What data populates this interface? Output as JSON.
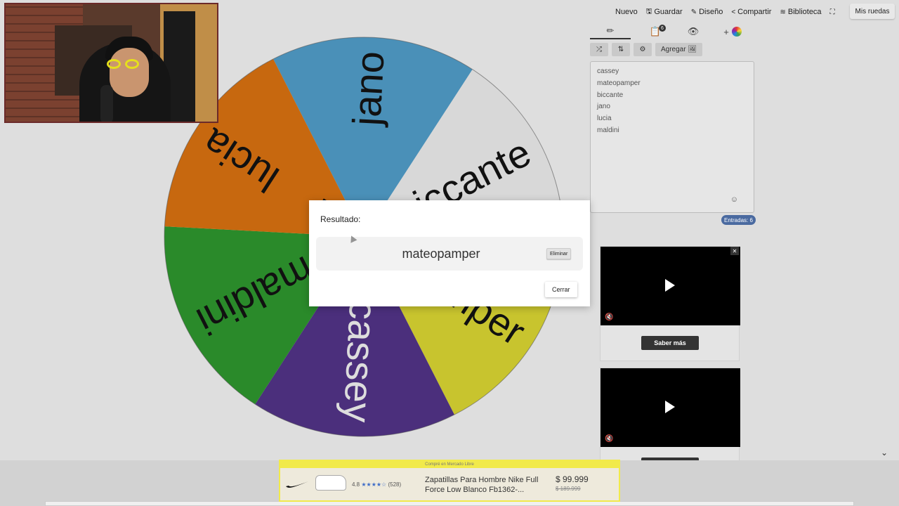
{
  "topmenu": {
    "nuevo": "Nuevo",
    "guardar": "Guardar",
    "diseno": "Diseño",
    "compartir": "Compartir",
    "biblioteca": "Biblioteca",
    "mis_ruedas": "Mis ruedas"
  },
  "tabs": {
    "list_badge": "6"
  },
  "toolbar": {
    "agregar": "Agregar"
  },
  "entries": [
    "cassey",
    "mateopamper",
    "biccante",
    "jano",
    "lucia",
    "maldini"
  ],
  "entries_count": "Entradas: 6",
  "wheel": {
    "slices": [
      {
        "label": "jano",
        "color": "#4a90b8"
      },
      {
        "label": "biccante",
        "color": "#d8d8d8"
      },
      {
        "label": "mateopamper",
        "color": "#c8c42e"
      },
      {
        "label": "cassey",
        "color": "#4b2f7c"
      },
      {
        "label": "maldini",
        "color": "#2a8a2a"
      },
      {
        "label": "lucia",
        "color": "#c7680f"
      }
    ]
  },
  "modal": {
    "title": "Resultado:",
    "winner": "mateopamper",
    "eliminar": "Eliminar",
    "cerrar": "Cerrar"
  },
  "ads": {
    "saber_mas": "Saber más"
  },
  "banner": {
    "strip": "Compré en Mercado Libre",
    "rating": "4.8",
    "reviews": "(528)",
    "title": "Zapatillas Para Hombre Nike Full Force Low Blanco Fb1362-...",
    "price": "$ 99.999",
    "old_price": "$ 189.999"
  }
}
